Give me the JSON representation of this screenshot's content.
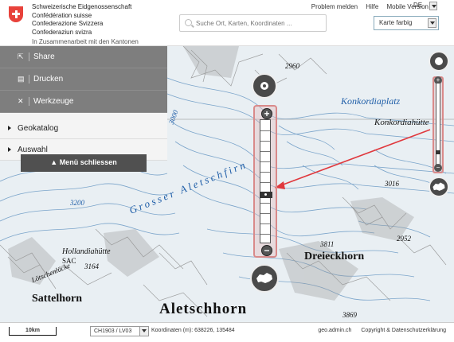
{
  "header": {
    "brand": [
      "Schweizerische Eidgenossenschaft",
      "Confédération suisse",
      "Confederazione Svizzera",
      "Confederaziun svizra"
    ],
    "collab": "In Zusammenarbeit mit den Kantonen",
    "search_placeholder": "Suche Ort, Karten, Koordinaten ...",
    "links": [
      "Problem melden",
      "Hilfe",
      "Mobile Version"
    ],
    "language": "DE",
    "basemap": "Karte farbig"
  },
  "menu": {
    "tools": [
      {
        "label": "Share",
        "icon": "share-icon"
      },
      {
        "label": "Drucken",
        "icon": "print-icon"
      },
      {
        "label": "Werkzeuge",
        "icon": "tools-icon"
      }
    ],
    "sections": [
      "Geokatalog",
      "Auswahl"
    ],
    "close_label": "▲ Menü schliessen"
  },
  "map": {
    "labels": {
      "konkordiaplatz": "Konkordiaplatz",
      "konkordiahutte": "Konkordiahütte",
      "grosser": "Grosser Aletschfirn",
      "hollandiahutte": "Hollandiahütte",
      "sac": "SAC",
      "lotschenlucke": "Lötschenlücke",
      "sattelhorn": "Sattelhorn",
      "dreieckhorn": "Dreieckhorn",
      "aletschhorn": "Aletschhorn",
      "e3000": "3000",
      "e3200": "3200",
      "e2960": "2960",
      "e3016": "3016",
      "e3164": "3164",
      "e2952": "2952",
      "e3811": "3811",
      "e3869": "3869"
    }
  },
  "footer": {
    "scale": "10km",
    "projection": "CH1903 / LV03",
    "coordinates": "Koordinaten (m): 638226, 135484",
    "links": [
      "geo.admin.ch",
      "Copyright & Datenschutzerklärung"
    ]
  },
  "colors": {
    "swiss_red": "#e8423b",
    "annotation_red": "#e0393e",
    "map_blue": "#1f5ea8"
  }
}
